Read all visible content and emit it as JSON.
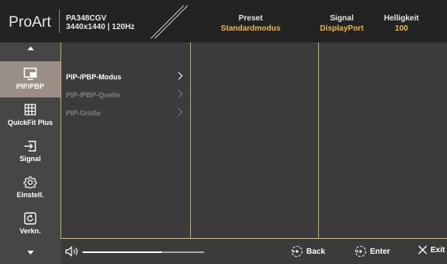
{
  "brand": "ProArt",
  "model": {
    "name": "PA348CGV",
    "spec": "3440x1440 | 120Hz"
  },
  "status": [
    {
      "label": "Preset",
      "value": "Standardmodus"
    },
    {
      "label": "Signal",
      "value": "DisplayPort"
    },
    {
      "label": "Helligkeit",
      "value": "100"
    }
  ],
  "sidebar": {
    "items": [
      {
        "label": "PIP/PBP",
        "icon": "pip-icon",
        "active": true
      },
      {
        "label": "QuickFit Plus",
        "icon": "grid-icon",
        "active": false
      },
      {
        "label": "Signal",
        "icon": "input-icon",
        "active": false
      },
      {
        "label": "Einstell.",
        "icon": "gear-icon",
        "active": false
      },
      {
        "label": "Verkn.",
        "icon": "shortcut-icon",
        "active": false
      }
    ]
  },
  "submenu": [
    {
      "label": "PIP-/PBP-Modus",
      "enabled": true
    },
    {
      "label": "PIP-/PBP-Quelle",
      "enabled": false
    },
    {
      "label": "PIP-Größe",
      "enabled": false
    }
  ],
  "footer": {
    "volume_level": 0.65,
    "back": "Back",
    "enter": "Enter",
    "exit": "Exit"
  },
  "colors": {
    "accent": "#f0b63d",
    "active_item": "#9a8f86",
    "line": "#e0b760"
  }
}
